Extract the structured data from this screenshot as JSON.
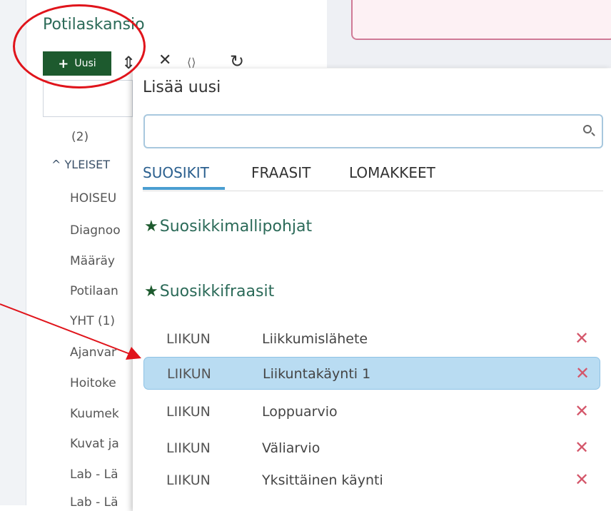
{
  "panel": {
    "title": "Potilaskansio",
    "new_button": "Uusi",
    "tree": {
      "count": "(2)",
      "group": "YLEISET",
      "items": [
        "HOISEU",
        "Diagnoo",
        "Määräy",
        "Potilaan",
        "YHT (1)",
        "Ajanvar",
        "Hoitoke",
        "Kuumek",
        "Kuvat ja",
        "Lab - Lä",
        "Lab - Lä"
      ]
    }
  },
  "popup": {
    "title": "Lisää uusi",
    "search": {
      "value": "",
      "placeholder": ""
    },
    "tabs": [
      {
        "label": "SUOSIKIT",
        "active": true
      },
      {
        "label": "FRAASIT",
        "active": false
      },
      {
        "label": "LOMAKKEET",
        "active": false
      }
    ],
    "sections": {
      "templates": "Suosikkimallipohjat",
      "phrases": "Suosikkifraasit"
    },
    "phrases": [
      {
        "code": "LIIKUN",
        "name": "Liikkumislähete",
        "selected": false
      },
      {
        "code": "LIIKUN",
        "name": "Liikuntakäynti 1",
        "selected": true
      },
      {
        "code": "LIIKUN",
        "name": "Loppuarvio",
        "selected": false
      },
      {
        "code": "LIIKUN",
        "name": "Väliarvio",
        "selected": false
      },
      {
        "code": "LIIKUN",
        "name": "Yksittäinen käynti",
        "selected": false
      }
    ],
    "delete_glyph": "✕"
  },
  "colors": {
    "accent_green": "#1d5a2e",
    "title_green": "#2b6a58",
    "tab_underline": "#4a9ed1",
    "selected_row": "#b9dcf2",
    "annotation_red": "#e0141b",
    "delete_red": "#d4566a"
  },
  "icons": [
    "plus-icon",
    "sort-icon",
    "close-icon",
    "link-icon",
    "refresh-icon",
    "search-icon",
    "star-icon",
    "delete-icon",
    "chevron-up-icon"
  ]
}
